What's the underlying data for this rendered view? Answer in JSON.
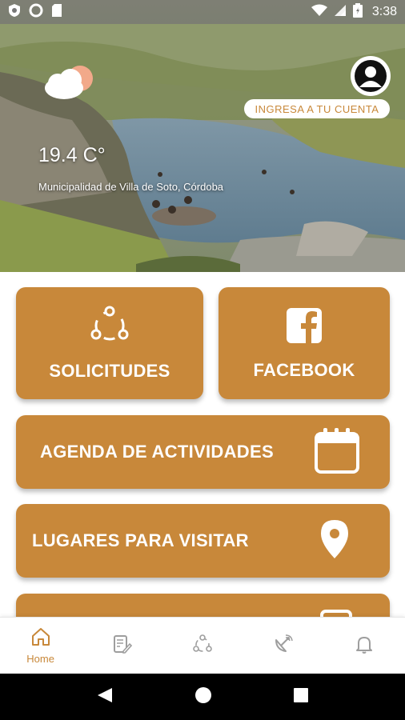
{
  "status_bar": {
    "time": "3:38",
    "icons": [
      "shield-icon",
      "sync-icon",
      "sd-card-icon",
      "wifi-icon",
      "signal-icon",
      "battery-icon"
    ]
  },
  "hero": {
    "temperature": "19.4 C°",
    "location": "Municipalidad de Villa de Soto, Córdoba",
    "weather_icon": "partly-cloudy-icon",
    "account_label": "INGRESA A TU CUENTA"
  },
  "tiles": [
    {
      "label": "SOLICITUDES",
      "icon": "share-icon"
    },
    {
      "label": "FACEBOOK",
      "icon": "facebook-icon"
    },
    {
      "label": "AGENDA DE ACTIVIDADES",
      "icon": "calendar-icon"
    },
    {
      "label": "LUGARES PARA VISITAR",
      "icon": "location-pin-icon"
    }
  ],
  "bottom_nav": {
    "items": [
      {
        "label": "Home",
        "icon": "home-icon",
        "active": true
      },
      {
        "label": "",
        "icon": "document-edit-icon"
      },
      {
        "label": "",
        "icon": "share-icon"
      },
      {
        "label": "",
        "icon": "satellite-dish-icon"
      },
      {
        "label": "",
        "icon": "bell-icon"
      }
    ]
  },
  "colors": {
    "accent": "#c8883a",
    "tile_text": "#ffffff",
    "nav_inactive": "#9e9e9e"
  }
}
